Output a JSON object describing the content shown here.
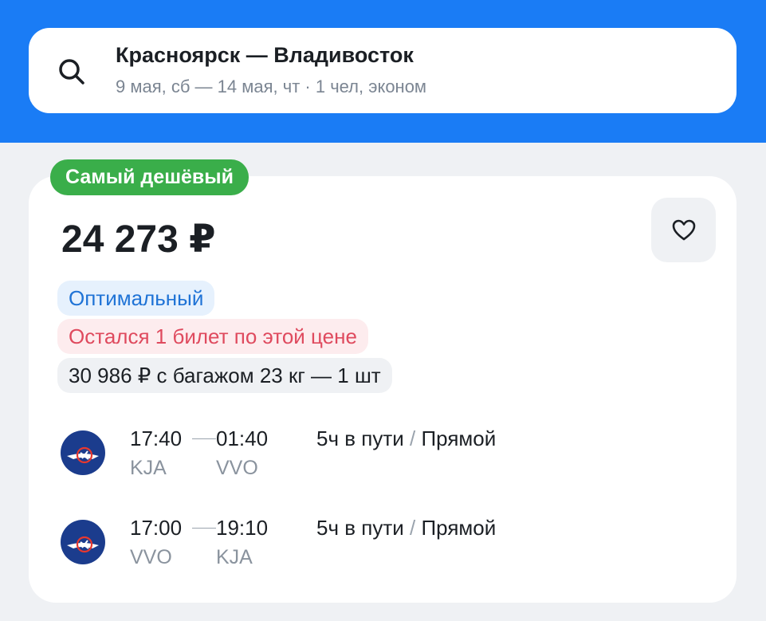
{
  "search": {
    "route": "Красноярск — Владивосток",
    "details": "9 мая, сб — 14 мая, чт · 1 чел, эконом"
  },
  "offer": {
    "badge": "Самый дешёвый",
    "price": "24 273 ₽",
    "tags": {
      "optimal": "Оптимальный",
      "last_ticket": "Остался 1 билет по этой цене",
      "baggage": "30 986 ₽ с багажом 23 кг — 1 шт"
    },
    "flights": [
      {
        "dep_time": "17:40",
        "arr_time": "01:40",
        "dep_code": "KJA",
        "arr_code": "VVO",
        "duration": "5ч в пути",
        "sep": "/",
        "type": "Прямой"
      },
      {
        "dep_time": "17:00",
        "arr_time": "19:10",
        "dep_code": "VVO",
        "arr_code": "KJA",
        "duration": "5ч в пути",
        "sep": "/",
        "type": "Прямой"
      }
    ]
  },
  "colors": {
    "header": "#1a7cf5",
    "badge": "#3aae4a",
    "optimal_text": "#1f73d6",
    "warning_text": "#df4a5e",
    "airline_logo": "#1b3c8d"
  },
  "icons": {
    "search": "search-icon",
    "favorite": "heart-icon",
    "airline": "airline-logo"
  }
}
